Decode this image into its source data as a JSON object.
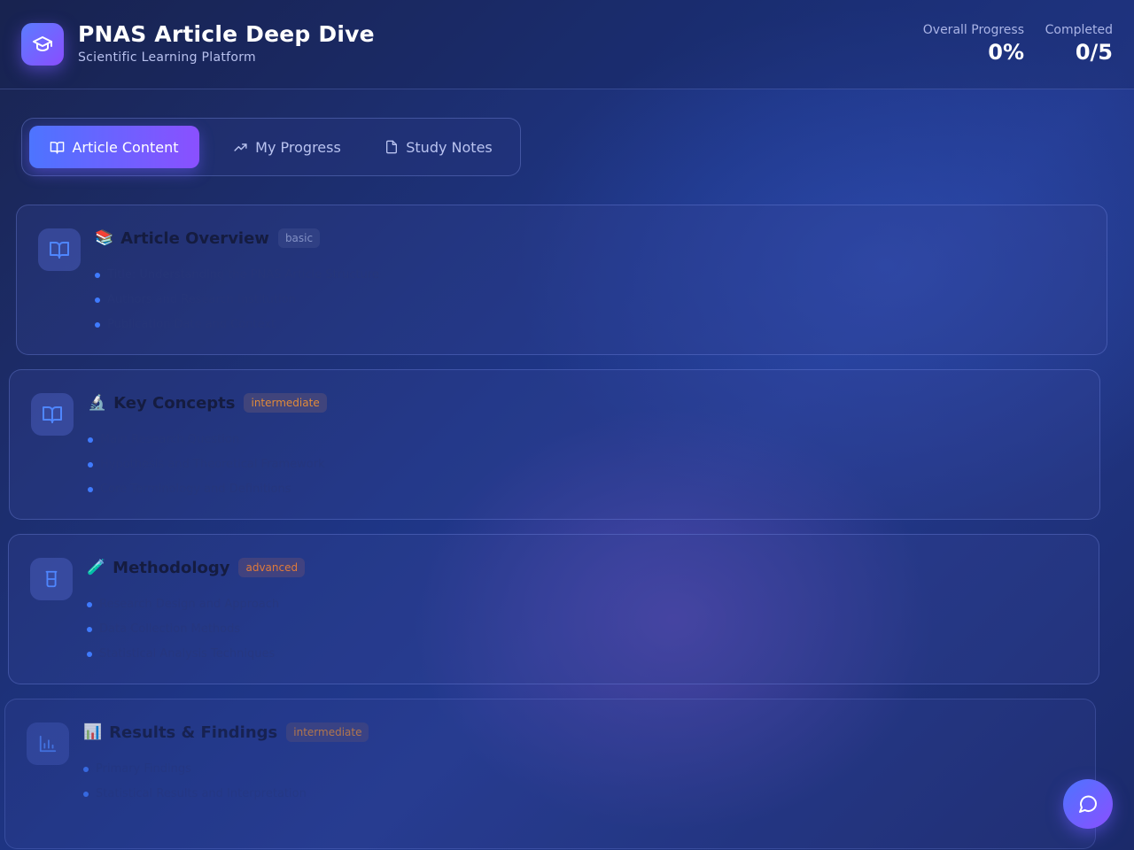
{
  "header": {
    "title": "PNAS Article Deep Dive",
    "subtitle": "Scientific Learning Platform",
    "logo_icon": "graduation-cap-icon",
    "overall_progress_label": "Overall Progress",
    "overall_progress_value": "0%",
    "completed_label": "Completed",
    "completed_value": "0/5"
  },
  "tabs": [
    {
      "label": "Article Content",
      "icon": "book-open-icon",
      "active": true
    },
    {
      "label": "My Progress",
      "icon": "trending-up-icon",
      "active": false
    },
    {
      "label": "Study Notes",
      "icon": "file-icon",
      "active": false
    }
  ],
  "sections": [
    {
      "emoji": "📚",
      "title": "Article Overview",
      "level": "basic",
      "icon": "book-open-icon",
      "items": [
        "Title: Understanding the PNAS Article Structure",
        "Authors and Research Institution",
        "Publication Date and Context"
      ]
    },
    {
      "emoji": "🔬",
      "title": "Key Concepts",
      "level": "intermediate",
      "icon": "book-open-icon",
      "items": [
        "Main Research Question",
        "Hypothesis and Theoretical Framework",
        "Core Terminology and Definitions"
      ]
    },
    {
      "emoji": "🧪",
      "title": "Methodology",
      "level": "advanced",
      "icon": "beaker-icon",
      "items": [
        "Research Design and Approach",
        "Data Collection Methods",
        "Statistical Analysis Techniques"
      ]
    },
    {
      "emoji": "📊",
      "title": "Results & Findings",
      "level": "intermediate",
      "icon": "bar-chart-icon",
      "items": [
        "Primary Findings",
        "Statistical Results and Interpretation"
      ]
    }
  ],
  "chat": {
    "icon": "chat-bubble-icon"
  },
  "colors": {
    "accent_start": "#4d74ff",
    "accent_end": "#8a50ff",
    "bullet": "#3f7bff",
    "badge_orange": "#e08a3a"
  }
}
